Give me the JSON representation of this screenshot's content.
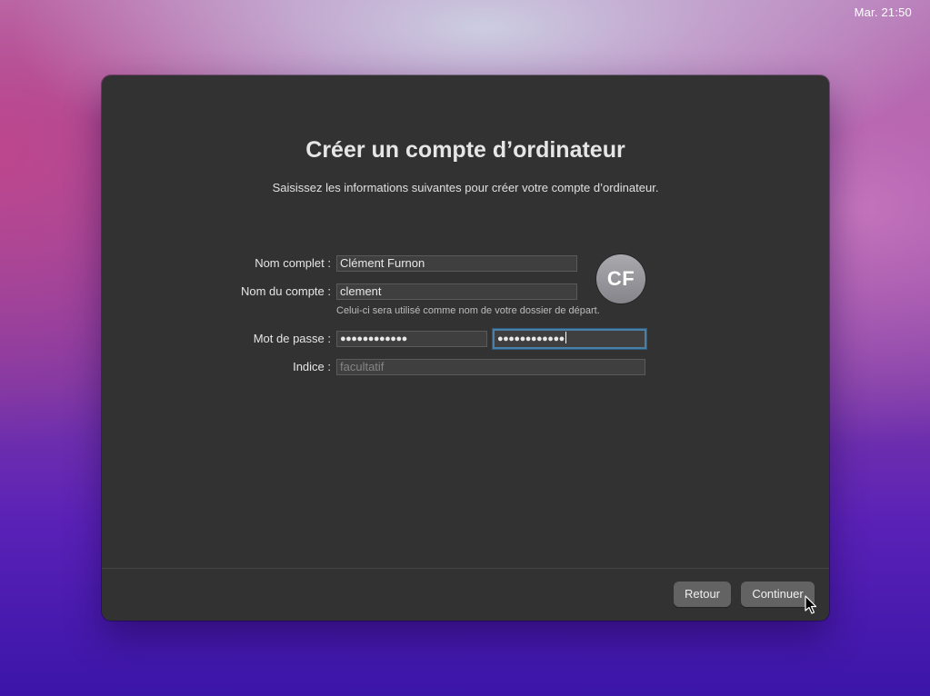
{
  "menubar": {
    "clock": "Mar. 21:50"
  },
  "dialog": {
    "title": "Créer un compte d’ordinateur",
    "subtitle": "Saisissez les informations suivantes pour créer votre compte d’ordinateur.",
    "full_name": {
      "label": "Nom complet :",
      "value": "Clément Furnon"
    },
    "account_name": {
      "label": "Nom du compte :",
      "value": "clement",
      "hint": "Celui-ci sera utilisé comme nom de votre dossier de départ."
    },
    "password": {
      "label": "Mot de passe :",
      "value": "●●●●●●●●●●●●",
      "verify_value": "●●●●●●●●●●●●"
    },
    "hint_field": {
      "label": "Indice :",
      "placeholder": "facultatif"
    },
    "avatar": {
      "initials": "CF"
    },
    "buttons": {
      "back": "Retour",
      "continue": "Continuer"
    }
  }
}
